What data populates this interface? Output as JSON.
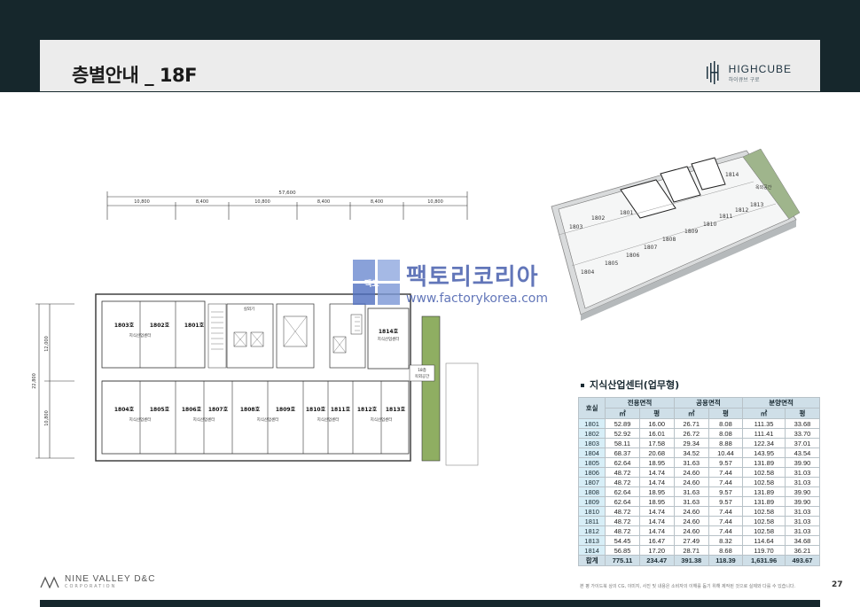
{
  "header": {
    "title": "층별안내 _ 18F",
    "brand_name": "HIGHCUBE",
    "brand_sub": "하이큐브 구로"
  },
  "plan": {
    "dim_total": "57,600",
    "dims": [
      "10,800",
      "8,400",
      "10,800",
      "8,400",
      "8,400",
      "10,800"
    ],
    "dims_vertical": [
      "22,800",
      "12,000",
      "10,800"
    ],
    "stair_label": "실외기",
    "rooms_top": [
      {
        "name": "1803호",
        "use": "지식산업센터"
      },
      {
        "name": "1802호",
        "use": ""
      },
      {
        "name": "1801호",
        "use": ""
      },
      {
        "name": "1814호",
        "use": "지식산업센터"
      }
    ],
    "rooms_bottom": [
      {
        "name": "1804호",
        "use": "지식산업센터"
      },
      {
        "name": "1805호",
        "use": ""
      },
      {
        "name": "1806호",
        "use": "지식산업센터"
      },
      {
        "name": "1807호",
        "use": ""
      },
      {
        "name": "1808호",
        "use": "지식산업센터"
      },
      {
        "name": "1809호",
        "use": ""
      },
      {
        "name": "1810호",
        "use": "지식산업센터"
      },
      {
        "name": "1811호",
        "use": ""
      },
      {
        "name": "1812호",
        "use": "지식산업센터"
      },
      {
        "name": "1813호",
        "use": ""
      }
    ],
    "garden_label_1": "18층",
    "garden_label_2": "옥외공간"
  },
  "iso": {
    "units": [
      "1801",
      "1802",
      "1803",
      "1804",
      "1805",
      "1806",
      "1807",
      "1808",
      "1809",
      "1810",
      "1811",
      "1812",
      "1813",
      "1814"
    ],
    "outdoor_label": "옥외공간"
  },
  "watermark": {
    "badge": "팩코",
    "name": "팩토리코리아",
    "url": "www.factorykorea.com"
  },
  "table": {
    "title": "지식산업센터(업무형)",
    "col_unit": "호실",
    "groups": [
      "전용면적",
      "공용면적",
      "분양면적"
    ],
    "sub": [
      "㎡",
      "평",
      "㎡",
      "평",
      "㎡",
      "평"
    ],
    "rows": [
      [
        "1801",
        "52.89",
        "16.00",
        "26.71",
        "8.08",
        "111.35",
        "33.68"
      ],
      [
        "1802",
        "52.92",
        "16.01",
        "26.72",
        "8.08",
        "111.41",
        "33.70"
      ],
      [
        "1803",
        "58.11",
        "17.58",
        "29.34",
        "8.88",
        "122.34",
        "37.01"
      ],
      [
        "1804",
        "68.37",
        "20.68",
        "34.52",
        "10.44",
        "143.95",
        "43.54"
      ],
      [
        "1805",
        "62.64",
        "18.95",
        "31.63",
        "9.57",
        "131.89",
        "39.90"
      ],
      [
        "1806",
        "48.72",
        "14.74",
        "24.60",
        "7.44",
        "102.58",
        "31.03"
      ],
      [
        "1807",
        "48.72",
        "14.74",
        "24.60",
        "7.44",
        "102.58",
        "31.03"
      ],
      [
        "1808",
        "62.64",
        "18.95",
        "31.63",
        "9.57",
        "131.89",
        "39.90"
      ],
      [
        "1809",
        "62.64",
        "18.95",
        "31.63",
        "9.57",
        "131.89",
        "39.90"
      ],
      [
        "1810",
        "48.72",
        "14.74",
        "24.60",
        "7.44",
        "102.58",
        "31.03"
      ],
      [
        "1811",
        "48.72",
        "14.74",
        "24.60",
        "7.44",
        "102.58",
        "31.03"
      ],
      [
        "1812",
        "48.72",
        "14.74",
        "24.60",
        "7.44",
        "102.58",
        "31.03"
      ],
      [
        "1813",
        "54.45",
        "16.47",
        "27.49",
        "8.32",
        "114.64",
        "34.68"
      ],
      [
        "1814",
        "56.85",
        "17.20",
        "28.71",
        "8.68",
        "119.70",
        "36.21"
      ]
    ],
    "total": [
      "합계",
      "775.11",
      "234.47",
      "391.38",
      "118.39",
      "1,631.96",
      "493.67"
    ]
  },
  "footer": {
    "company": "NINE VALLEY D&C",
    "company_sub": "CORPORATION",
    "note": "본 평 가이드북 상의 CG, 이미지, 사진 및 내용은 소비자의 이해를 돕기 위해 제작된 것으로 실제와 다를 수 있습니다.",
    "page": "27"
  },
  "colors": {
    "navy": "#16272c",
    "table_header": "#cfdfe8",
    "unit_cell": "#d7eef7",
    "garden": "#8fae62",
    "watermark": "#3c55a8"
  }
}
